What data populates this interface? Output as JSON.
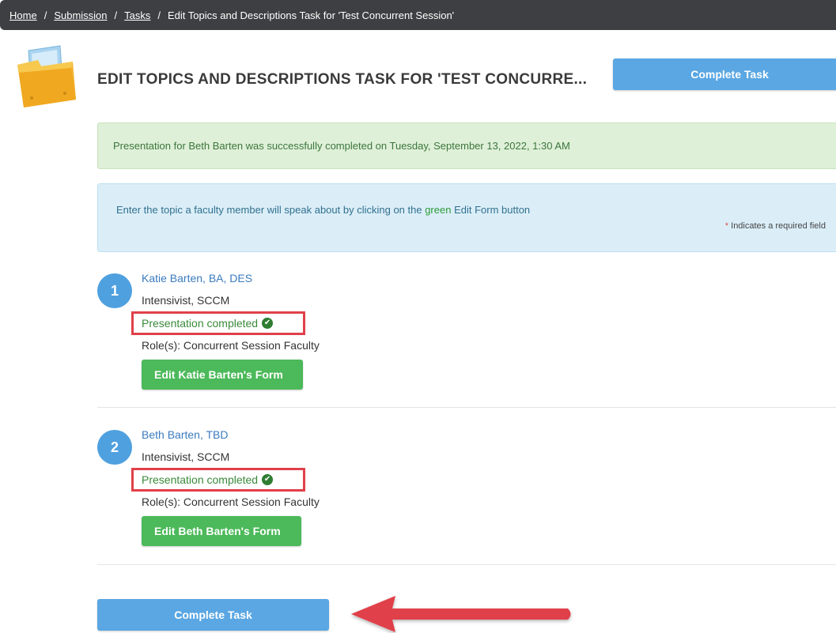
{
  "breadcrumb": {
    "home": "Home",
    "submission": "Submission",
    "tasks": "Tasks",
    "current": "Edit Topics and Descriptions Task for 'Test Concurrent Session'",
    "separator": "/"
  },
  "header": {
    "title": "EDIT TOPICS AND DESCRIPTIONS TASK FOR 'TEST CONCURRE...",
    "complete_button": "Complete Task"
  },
  "success_alert": {
    "text": "Presentation for Beth Barten was successfully completed on Tuesday, September 13, 2022, 1:30 AM"
  },
  "info_alert": {
    "text_before": "Enter the topic a faculty member will speak about by clicking on the ",
    "text_green": "green",
    "text_after": " Edit Form button",
    "required_star": "*",
    "required_text": " Indicates a required field"
  },
  "faculty": [
    {
      "number": "1",
      "name": "Katie Barten, BA, DES",
      "title": "Intensivist, SCCM",
      "status": "Presentation completed",
      "roles": "Role(s): Concurrent Session Faculty",
      "edit_button": "Edit Katie Barten's Form"
    },
    {
      "number": "2",
      "name": "Beth Barten, TBD",
      "title": "Intensivist, SCCM",
      "status": "Presentation completed",
      "roles": "Role(s): Concurrent Session Faculty",
      "edit_button": "Edit Beth Barten's Form"
    }
  ],
  "footer": {
    "complete_button": "Complete Task"
  },
  "colors": {
    "breadcrumb_bg": "#3d3f42",
    "primary_blue": "#5aa7e3",
    "success_green": "#4cb95a",
    "highlight_red": "#e0404a",
    "arrow_red": "#e0404a"
  },
  "icons": {
    "folder": "folder-icon",
    "check": "check-circle-icon",
    "arrow": "arrow-left-icon"
  }
}
